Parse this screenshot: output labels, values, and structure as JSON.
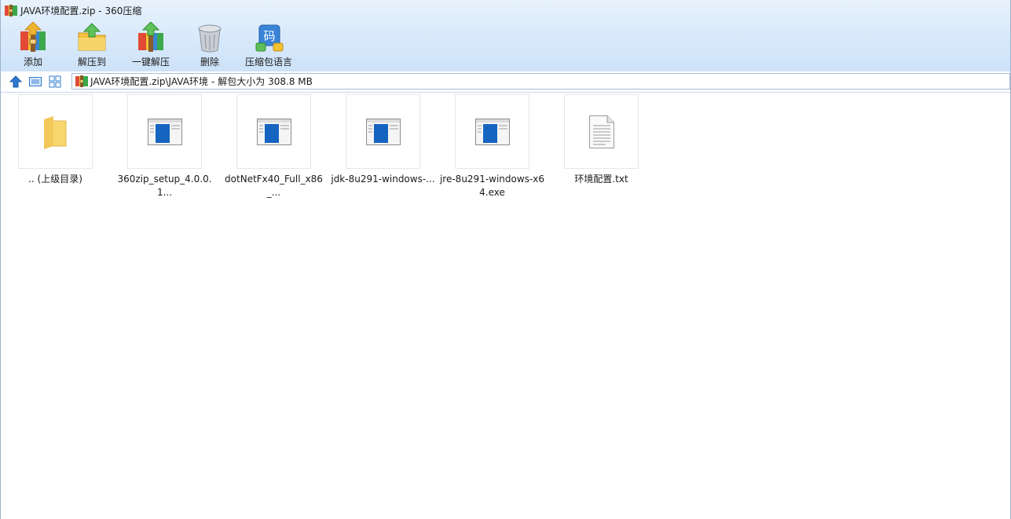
{
  "window": {
    "title": "JAVA环境配置.zip - 360压缩"
  },
  "toolbar": {
    "buttons": [
      {
        "label": "添加",
        "icon": "add-archive-icon"
      },
      {
        "label": "解压到",
        "icon": "extract-to-folder-icon"
      },
      {
        "label": "一键解压",
        "icon": "one-click-extract-icon"
      },
      {
        "label": "删除",
        "icon": "trash-bin-icon"
      },
      {
        "label": "压缩包语言",
        "icon": "archive-language-icon"
      }
    ],
    "language_glyph": "码"
  },
  "nav": {
    "up_icon": "up-arrow-icon",
    "large_view_icon": "large-icon-view-icon",
    "grid_view_icon": "grid-view-icon",
    "path": "JAVA环境配置.zip\\JAVA环境",
    "size_info": "解包大小为 308.8 MB"
  },
  "files": [
    {
      "name": ".. (上级目录)",
      "type": "folder",
      "icon": "folder-icon"
    },
    {
      "name": "360zip_setup_4.0.0.1...",
      "type": "exe",
      "icon": "exe-window-icon"
    },
    {
      "name": "dotNetFx40_Full_x86_...",
      "type": "exe",
      "icon": "exe-window-icon"
    },
    {
      "name": "jdk-8u291-windows-...",
      "type": "exe",
      "icon": "exe-window-icon"
    },
    {
      "name": "jre-8u291-windows-x64.exe",
      "type": "exe",
      "icon": "exe-window-icon"
    },
    {
      "name": "环境配置.txt",
      "type": "txt",
      "icon": "text-document-icon"
    }
  ],
  "colors": {
    "chrome_top": "#e8f2fd",
    "chrome_bottom": "#cde2f8",
    "exe_blue": "#1565c0",
    "folder_yellow": "#f7d66e",
    "nav_blue": "#2f7ad0"
  }
}
